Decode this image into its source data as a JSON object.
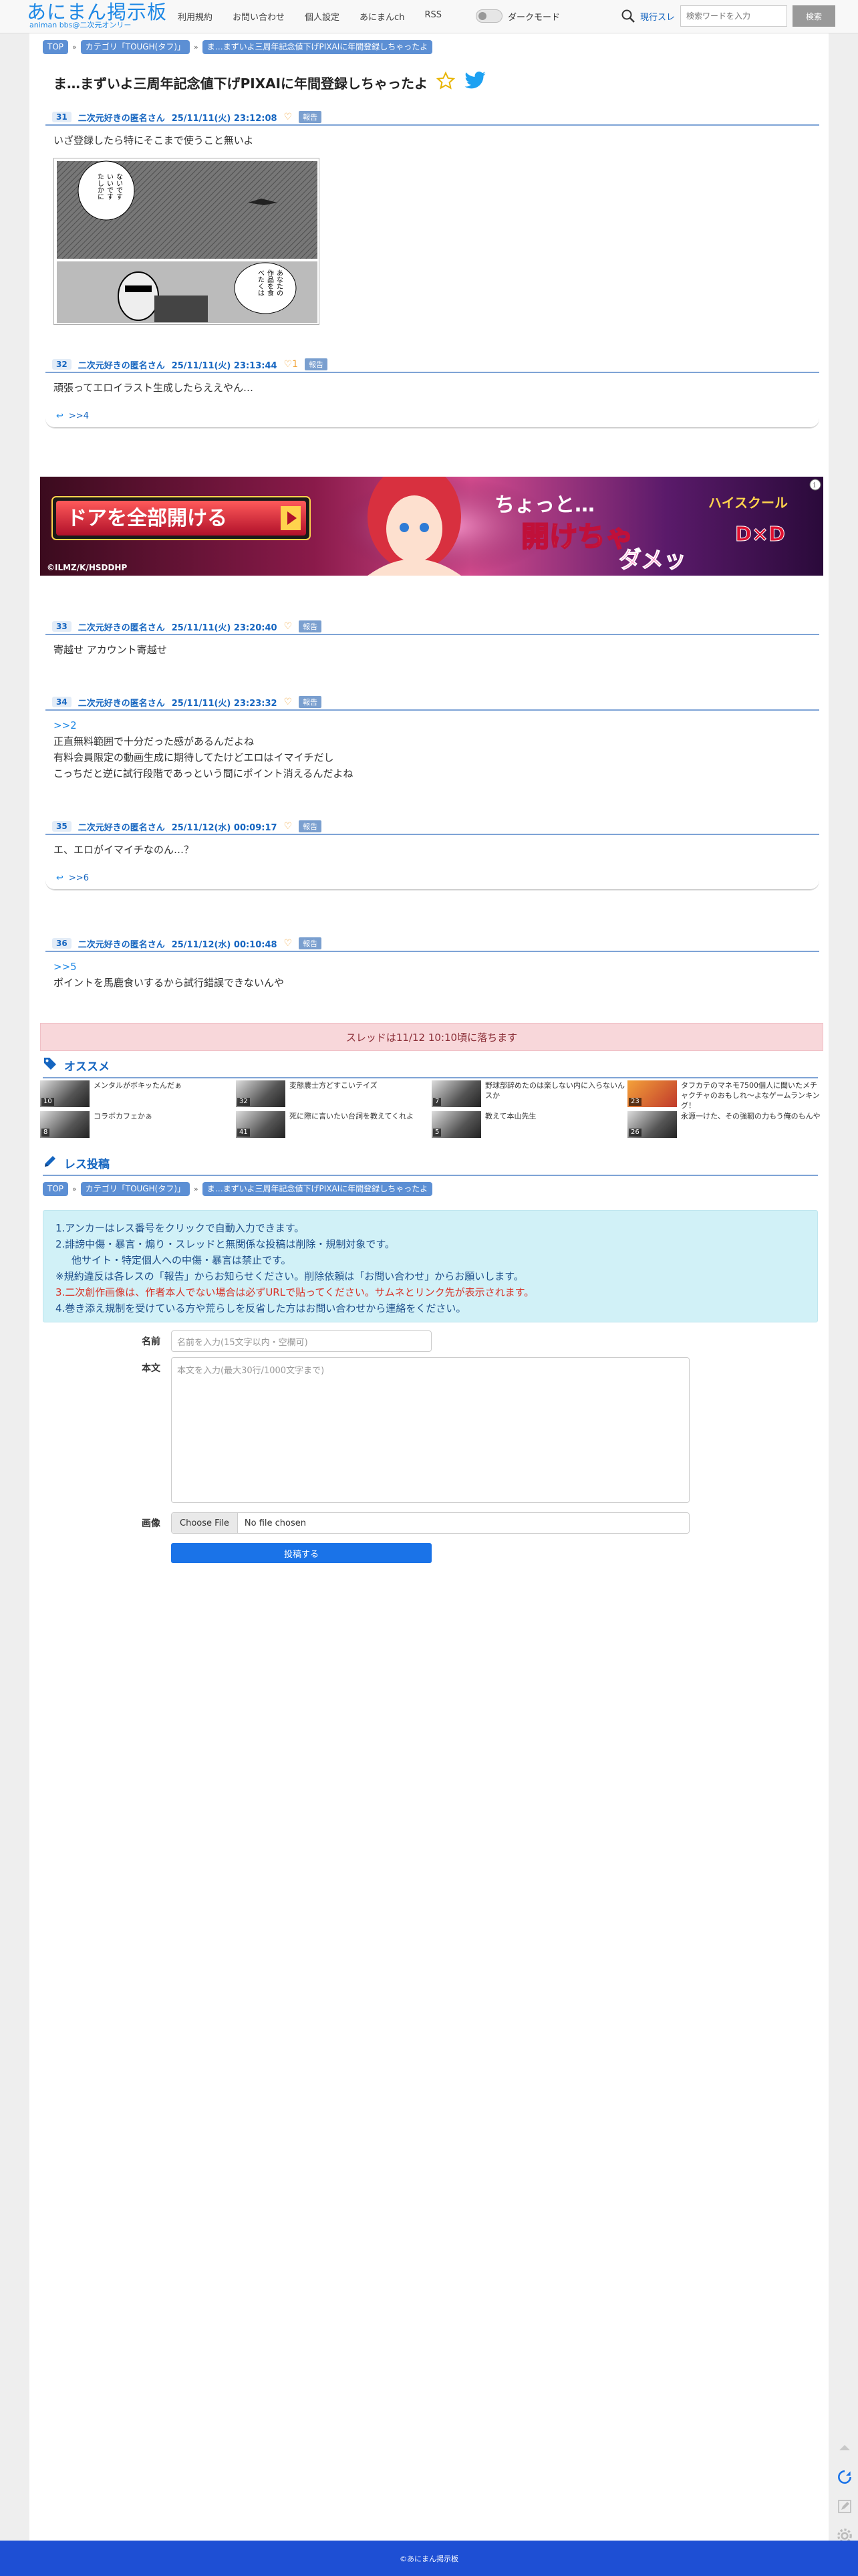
{
  "header": {
    "logo_main": "あにまん掲示板",
    "logo_sub": "animan bbs@二次元オンリー",
    "nav": [
      "利用規約",
      "お問い合わせ",
      "個人設定",
      "あにまんch",
      "RSS"
    ],
    "dark_mode_label": "ダークモード",
    "search_scope": "現行スレ",
    "search_placeholder": "検索ワードを入力",
    "search_button": "検索"
  },
  "breadcrumbs": [
    "TOP",
    "カテゴリ「TOUGH(タフ)」",
    "ま…まずいよ三周年記念値下げPIXAIに年間登録しちゃったよ"
  ],
  "thread_title": "ま…まずいよ三周年記念値下げPIXAIに年間登録しちゃったよ",
  "report_label": "報告",
  "posts": [
    {
      "no": "31",
      "author": "二次元好きの匿名さん",
      "date": "25/11/11(火) 23:12:08",
      "likes": "",
      "reply_to": "",
      "lines": [
        "いざ登録したら特にそこまで使うこと無いよ"
      ],
      "reply_from": ""
    },
    {
      "no": "32",
      "author": "二次元好きの匿名さん",
      "date": "25/11/11(火) 23:13:44",
      "likes": "1",
      "reply_to": "",
      "lines": [
        "頑張ってエロイラスト生成したらええやん…"
      ],
      "reply_from": ">>4"
    },
    {
      "no": "33",
      "author": "二次元好きの匿名さん",
      "date": "25/11/11(火) 23:20:40",
      "likes": "",
      "reply_to": "",
      "lines": [
        "寄越せ アカウント寄越せ"
      ],
      "reply_from": ""
    },
    {
      "no": "34",
      "author": "二次元好きの匿名さん",
      "date": "25/11/11(火) 23:23:32",
      "likes": "",
      "reply_to": ">>2",
      "lines": [
        "正直無料範囲で十分だった感があるんだよね",
        "有料会員限定の動画生成に期待してたけどエロはイマイチだし",
        "こっちだと逆に試行段階であっという間にポイント消えるんだよね"
      ],
      "reply_from": ""
    },
    {
      "no": "35",
      "author": "二次元好きの匿名さん",
      "date": "25/11/12(水) 00:09:17",
      "likes": "",
      "reply_to": "",
      "lines": [
        "エ、エロがイマイチなのん…？"
      ],
      "reply_from": ">>6"
    },
    {
      "no": "36",
      "author": "二次元好きの匿名さん",
      "date": "25/11/12(水) 00:10:48",
      "likes": "",
      "reply_to": ">>5",
      "lines": [
        "ポイントを馬鹿食いするから試行錯誤できないんや"
      ],
      "reply_from": ""
    }
  ],
  "manga_speech": [
    "ないです",
    "いいです",
    "たしかに",
    "あなたの",
    "作品を食",
    "べたくは"
  ],
  "ad": {
    "cta": "ドアを全部開ける",
    "headline_1": "ちょっと…",
    "headline_2": "開けちゃ",
    "headline_3": "ダメッ",
    "title_art": "ハイスクール",
    "title_logo": "D×D",
    "copyright": "©ILMZ/K/HSDDHP"
  },
  "closed_notice": "スレッドは11/12 10:10頃に落ちます",
  "recommend": {
    "title": "オススメ",
    "items": [
      {
        "count": "10",
        "title": "メンタルがボキッたんだぁ"
      },
      {
        "count": "32",
        "title": "変態農士方どすこいテイズ"
      },
      {
        "count": "7",
        "title": "野球部辞めたのは楽しない内に入らないんスか"
      },
      {
        "count": "23",
        "title": "タフカテのマネモ7500個人に聞いたメチャクチャのおもしれ〜よなゲームランキング！"
      },
      {
        "count": "8",
        "title": "コラボカフェかぁ"
      },
      {
        "count": "41",
        "title": "死に際に言いたい台詞を教えてくれよ"
      },
      {
        "count": "5",
        "title": "教えて本山先生"
      },
      {
        "count": "26",
        "title": "永源一けた、その強靭の力もう俺のもんや"
      }
    ]
  },
  "post_form": {
    "title": "レス投稿",
    "rules": [
      "1.アンカーはレス番号をクリックで自動入力できます。",
      "2.誹謗中傷・暴言・煽り・スレッドと無関係な投稿は削除・規制対象です。",
      "他サイト・特定個人への中傷・暴言は禁止です。",
      "※規約違反は各レスの「報告」からお知らせください。削除依頼は「お問い合わせ」からお願いします。",
      "3.二次創作画像は、作者本人でない場合は必ずURLで貼ってください。サムネとリンク先が表示されます。",
      "4.巻き添え規制を受けている方や荒らしを反省した方はお問い合わせから連絡をください。"
    ],
    "name_label": "名前",
    "name_placeholder": "名前を入力(15文字以内・空欄可)",
    "body_label": "本文",
    "body_placeholder": "本文を入力(最大30行/1000文字まで)",
    "image_label": "画像",
    "file_button": "Choose File",
    "file_status": "No file chosen",
    "submit": "投稿する"
  },
  "footer": "©あにまん掲示板",
  "colors": {
    "accent": "#1e88e5",
    "header_bg": "#f8f8f8",
    "footer": "#1e4fd4",
    "notice_bg": "#f8d7da",
    "info_bg": "#d1f1f7"
  }
}
